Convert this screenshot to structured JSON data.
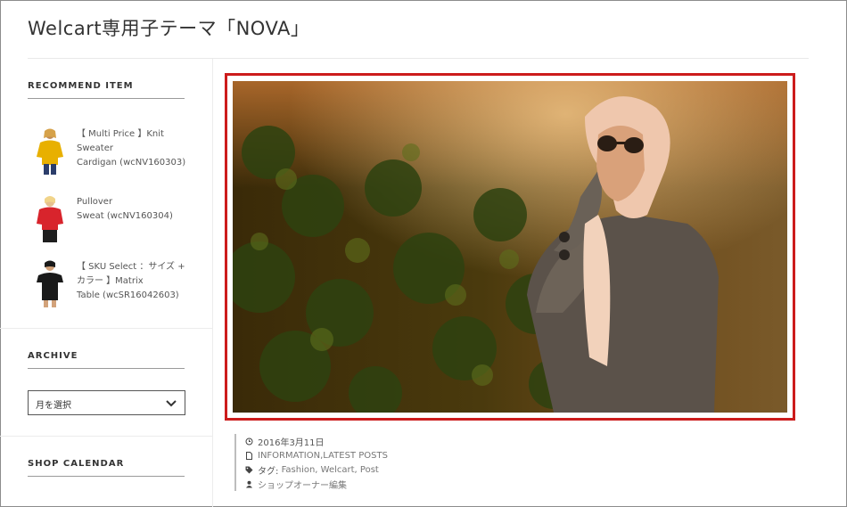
{
  "site": {
    "title": "Welcart専用子テーマ「NOVA」"
  },
  "sidebar": {
    "recommend": {
      "title": "RECOMMEND ITEM",
      "items": [
        {
          "lines": [
            "【 Multi Price 】Knit",
            "Sweater",
            "Cardigan (wcNV160303)"
          ],
          "thumb_color": "#e8b000"
        },
        {
          "lines": [
            "Pullover",
            "Sweat (wcNV160304)"
          ],
          "thumb_color": "#d8242c"
        },
        {
          "lines": [
            "【 SKU Select ：サイズ +",
            "カラー 】Matrix",
            "Table (wcSR16042603)"
          ],
          "thumb_color": "#1a1a1a"
        }
      ]
    },
    "archive": {
      "title": "ARCHIVE",
      "select_value": "月を選択"
    },
    "calendar": {
      "title": "SHOP CALENDAR"
    }
  },
  "post_meta": {
    "date": "2016年3月11日",
    "categories": "INFORMATION,LATEST POSTS",
    "tags_label": "タグ:",
    "tags": "Fashion, Welcart, Post",
    "author": "ショップオーナー編集"
  }
}
